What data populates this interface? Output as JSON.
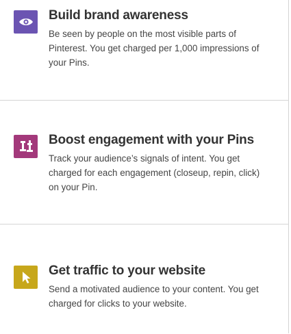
{
  "options": [
    {
      "title": "Build brand awareness",
      "description": "Be seen by people on the most visible parts of Pinterest. You get charged per 1,000 impressions of your Pins.",
      "icon": "eye-icon",
      "icon_color": "#6b54b2"
    },
    {
      "title": "Boost engagement with your Pins",
      "description": "Track your audience’s signals of intent. You get charged for each engagement (closeup, repin, click) on your Pin.",
      "icon": "engagement-icon",
      "icon_color": "#a3397b"
    },
    {
      "title": "Get traffic to your website",
      "description": "Send a motivated audience to your content. You get charged for clicks to your website.",
      "icon": "cursor-icon",
      "icon_color": "#c7a71b"
    }
  ]
}
